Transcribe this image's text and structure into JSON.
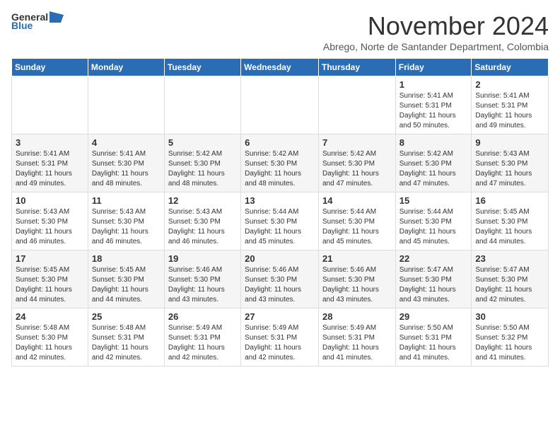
{
  "logo": {
    "general": "General",
    "blue": "Blue"
  },
  "title": "November 2024",
  "subtitle": "Abrego, Norte de Santander Department, Colombia",
  "days_header": [
    "Sunday",
    "Monday",
    "Tuesday",
    "Wednesday",
    "Thursday",
    "Friday",
    "Saturday"
  ],
  "weeks": [
    [
      {
        "day": "",
        "content": ""
      },
      {
        "day": "",
        "content": ""
      },
      {
        "day": "",
        "content": ""
      },
      {
        "day": "",
        "content": ""
      },
      {
        "day": "",
        "content": ""
      },
      {
        "day": "1",
        "content": "Sunrise: 5:41 AM\nSunset: 5:31 PM\nDaylight: 11 hours and 50 minutes."
      },
      {
        "day": "2",
        "content": "Sunrise: 5:41 AM\nSunset: 5:31 PM\nDaylight: 11 hours and 49 minutes."
      }
    ],
    [
      {
        "day": "3",
        "content": "Sunrise: 5:41 AM\nSunset: 5:31 PM\nDaylight: 11 hours and 49 minutes."
      },
      {
        "day": "4",
        "content": "Sunrise: 5:41 AM\nSunset: 5:30 PM\nDaylight: 11 hours and 48 minutes."
      },
      {
        "day": "5",
        "content": "Sunrise: 5:42 AM\nSunset: 5:30 PM\nDaylight: 11 hours and 48 minutes."
      },
      {
        "day": "6",
        "content": "Sunrise: 5:42 AM\nSunset: 5:30 PM\nDaylight: 11 hours and 48 minutes."
      },
      {
        "day": "7",
        "content": "Sunrise: 5:42 AM\nSunset: 5:30 PM\nDaylight: 11 hours and 47 minutes."
      },
      {
        "day": "8",
        "content": "Sunrise: 5:42 AM\nSunset: 5:30 PM\nDaylight: 11 hours and 47 minutes."
      },
      {
        "day": "9",
        "content": "Sunrise: 5:43 AM\nSunset: 5:30 PM\nDaylight: 11 hours and 47 minutes."
      }
    ],
    [
      {
        "day": "10",
        "content": "Sunrise: 5:43 AM\nSunset: 5:30 PM\nDaylight: 11 hours and 46 minutes."
      },
      {
        "day": "11",
        "content": "Sunrise: 5:43 AM\nSunset: 5:30 PM\nDaylight: 11 hours and 46 minutes."
      },
      {
        "day": "12",
        "content": "Sunrise: 5:43 AM\nSunset: 5:30 PM\nDaylight: 11 hours and 46 minutes."
      },
      {
        "day": "13",
        "content": "Sunrise: 5:44 AM\nSunset: 5:30 PM\nDaylight: 11 hours and 45 minutes."
      },
      {
        "day": "14",
        "content": "Sunrise: 5:44 AM\nSunset: 5:30 PM\nDaylight: 11 hours and 45 minutes."
      },
      {
        "day": "15",
        "content": "Sunrise: 5:44 AM\nSunset: 5:30 PM\nDaylight: 11 hours and 45 minutes."
      },
      {
        "day": "16",
        "content": "Sunrise: 5:45 AM\nSunset: 5:30 PM\nDaylight: 11 hours and 44 minutes."
      }
    ],
    [
      {
        "day": "17",
        "content": "Sunrise: 5:45 AM\nSunset: 5:30 PM\nDaylight: 11 hours and 44 minutes."
      },
      {
        "day": "18",
        "content": "Sunrise: 5:45 AM\nSunset: 5:30 PM\nDaylight: 11 hours and 44 minutes."
      },
      {
        "day": "19",
        "content": "Sunrise: 5:46 AM\nSunset: 5:30 PM\nDaylight: 11 hours and 43 minutes."
      },
      {
        "day": "20",
        "content": "Sunrise: 5:46 AM\nSunset: 5:30 PM\nDaylight: 11 hours and 43 minutes."
      },
      {
        "day": "21",
        "content": "Sunrise: 5:46 AM\nSunset: 5:30 PM\nDaylight: 11 hours and 43 minutes."
      },
      {
        "day": "22",
        "content": "Sunrise: 5:47 AM\nSunset: 5:30 PM\nDaylight: 11 hours and 43 minutes."
      },
      {
        "day": "23",
        "content": "Sunrise: 5:47 AM\nSunset: 5:30 PM\nDaylight: 11 hours and 42 minutes."
      }
    ],
    [
      {
        "day": "24",
        "content": "Sunrise: 5:48 AM\nSunset: 5:30 PM\nDaylight: 11 hours and 42 minutes."
      },
      {
        "day": "25",
        "content": "Sunrise: 5:48 AM\nSunset: 5:31 PM\nDaylight: 11 hours and 42 minutes."
      },
      {
        "day": "26",
        "content": "Sunrise: 5:49 AM\nSunset: 5:31 PM\nDaylight: 11 hours and 42 minutes."
      },
      {
        "day": "27",
        "content": "Sunrise: 5:49 AM\nSunset: 5:31 PM\nDaylight: 11 hours and 42 minutes."
      },
      {
        "day": "28",
        "content": "Sunrise: 5:49 AM\nSunset: 5:31 PM\nDaylight: 11 hours and 41 minutes."
      },
      {
        "day": "29",
        "content": "Sunrise: 5:50 AM\nSunset: 5:31 PM\nDaylight: 11 hours and 41 minutes."
      },
      {
        "day": "30",
        "content": "Sunrise: 5:50 AM\nSunset: 5:32 PM\nDaylight: 11 hours and 41 minutes."
      }
    ]
  ]
}
